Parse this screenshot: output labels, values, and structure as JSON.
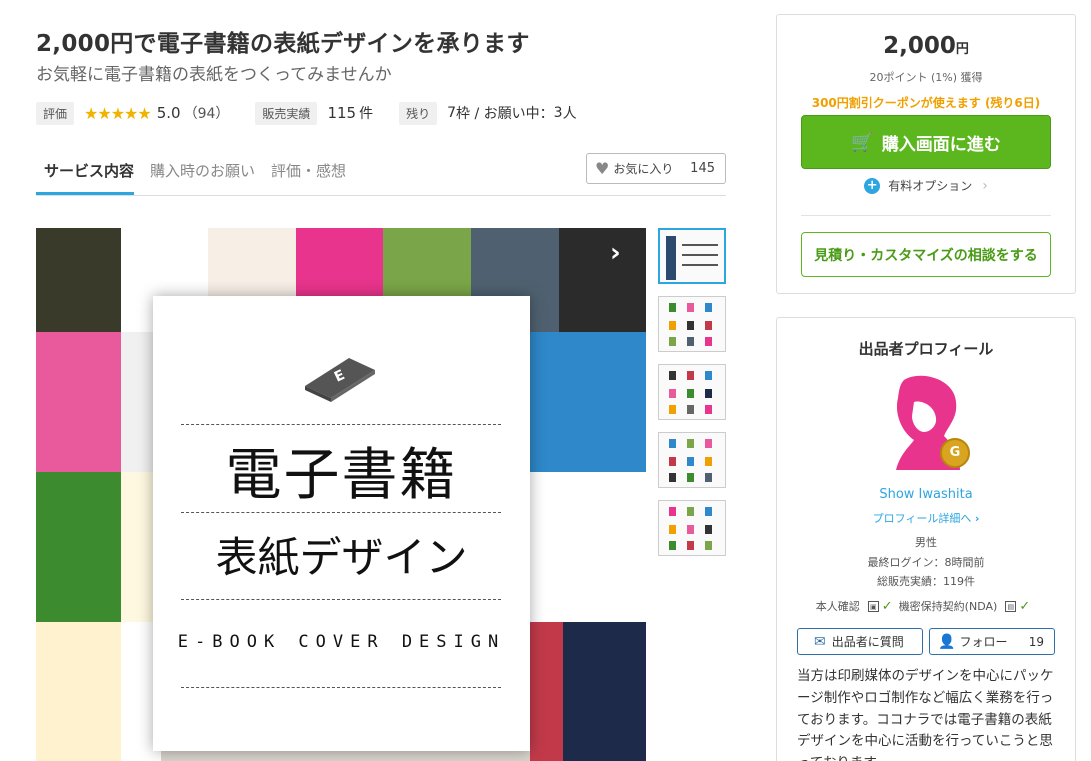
{
  "header": {
    "title": "2,000円で電子書籍の表紙デザインを承ります",
    "subtitle": "お気軽に電子書籍の表紙をつくってみませんか"
  },
  "stats": {
    "rating_tag": "評価",
    "stars": "★★★★★",
    "rating": "5.0",
    "reviews": "（94）",
    "sales_tag": "販売実績",
    "sales_value": "115",
    "sales_unit": "件",
    "remaining_tag": "残り",
    "remaining_value": "7",
    "remaining_text": "枠 / お願い中：",
    "requesting_value": "3",
    "requesting_unit": "人"
  },
  "tabs": [
    {
      "label": "サービス内容"
    },
    {
      "label": "購入時のお願い"
    },
    {
      "label": "評価・感想"
    }
  ],
  "favorite": {
    "label": "お気に入り",
    "count": "145"
  },
  "cover": {
    "line1": "電子書籍",
    "line2": "表紙デザイン",
    "line3": "E-BOOK COVER DESIGN"
  },
  "purchase": {
    "price": "2,000",
    "currency": "円",
    "points": "20ポイント (1%) 獲得",
    "coupon": "300円割引クーポンが使えます (残り6日)",
    "buy_label": "購入画面に進む",
    "option_label": "有料オプション",
    "consult_label": "見積り・カスタマイズの相談をする"
  },
  "profile": {
    "heading": "出品者プロフィール",
    "name": "Show Iwashita",
    "detail_link": "プロフィール詳細へ",
    "gender": "男性",
    "last_login": "最終ログイン：8時間前",
    "total_sales": "総販売実績：119件",
    "identity": "本人確認",
    "nda": "機密保持契約(NDA)",
    "question_label": "出品者に質問",
    "follow_label": "フォロー",
    "follow_count": "19",
    "badge_letter": "G",
    "bio": "当方は印刷媒体のデザインを中心にパッケージ制作やロゴ制作など幅広く業務を行っております。ココナラでは電子書籍の表紙デザインを中心に活動を行っていこうと思っております。"
  },
  "colors": {
    "accent": "#2ca6e0",
    "buy_green": "#5cb71e",
    "coupon": "#f0a000",
    "star": "#f0b400"
  }
}
